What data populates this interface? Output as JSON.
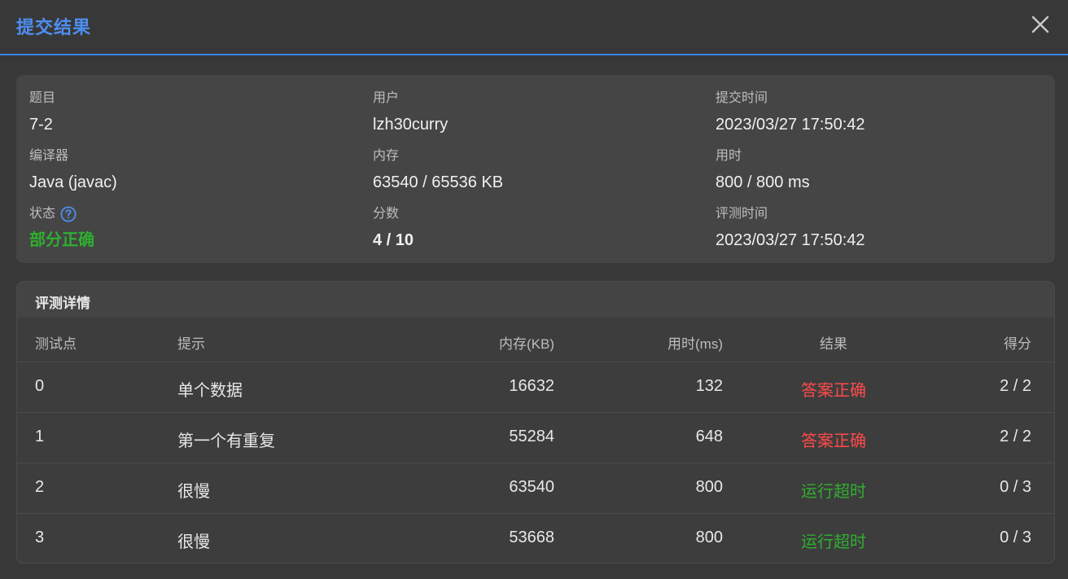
{
  "header": {
    "title": "提交结果"
  },
  "info": {
    "problem_label": "题目",
    "problem_value": "7-2",
    "user_label": "用户",
    "user_value": "lzh30curry",
    "submit_time_label": "提交时间",
    "submit_time_value": "2023/03/27 17:50:42",
    "compiler_label": "编译器",
    "compiler_value": "Java (javac)",
    "memory_label": "内存",
    "memory_value": "63540 / 65536 KB",
    "time_used_label": "用时",
    "time_used_value": "800 / 800 ms",
    "status_label": "状态",
    "status_value": "部分正确",
    "score_label": "分数",
    "score_value": "4 / 10",
    "judge_time_label": "评测时间",
    "judge_time_value": "2023/03/27 17:50:42"
  },
  "details": {
    "title": "评测详情",
    "columns": {
      "case": "测试点",
      "hint": "提示",
      "memory": "内存(KB)",
      "time": "用时(ms)",
      "result": "结果",
      "score": "得分"
    },
    "rows": [
      {
        "case": "0",
        "hint": "单个数据",
        "memory": "16632",
        "time": "132",
        "result": "答案正确",
        "score": "2 / 2"
      },
      {
        "case": "1",
        "hint": "第一个有重复",
        "memory": "55284",
        "time": "648",
        "result": "答案正确",
        "score": "2 / 2"
      },
      {
        "case": "2",
        "hint": "很慢",
        "memory": "63540",
        "time": "800",
        "result": "运行超时",
        "score": "0 / 3"
      },
      {
        "case": "3",
        "hint": "很慢",
        "memory": "53668",
        "time": "800",
        "result": "运行超时",
        "score": "0 / 3"
      }
    ]
  },
  "colors": {
    "accent": "#4d8ff0",
    "partial_correct": "#2fae2f",
    "answer_correct": "#ff4a4a",
    "time_limit_exceeded": "#2fae2f"
  },
  "icons": {
    "close": "close-icon",
    "help": "question-circle-icon"
  }
}
